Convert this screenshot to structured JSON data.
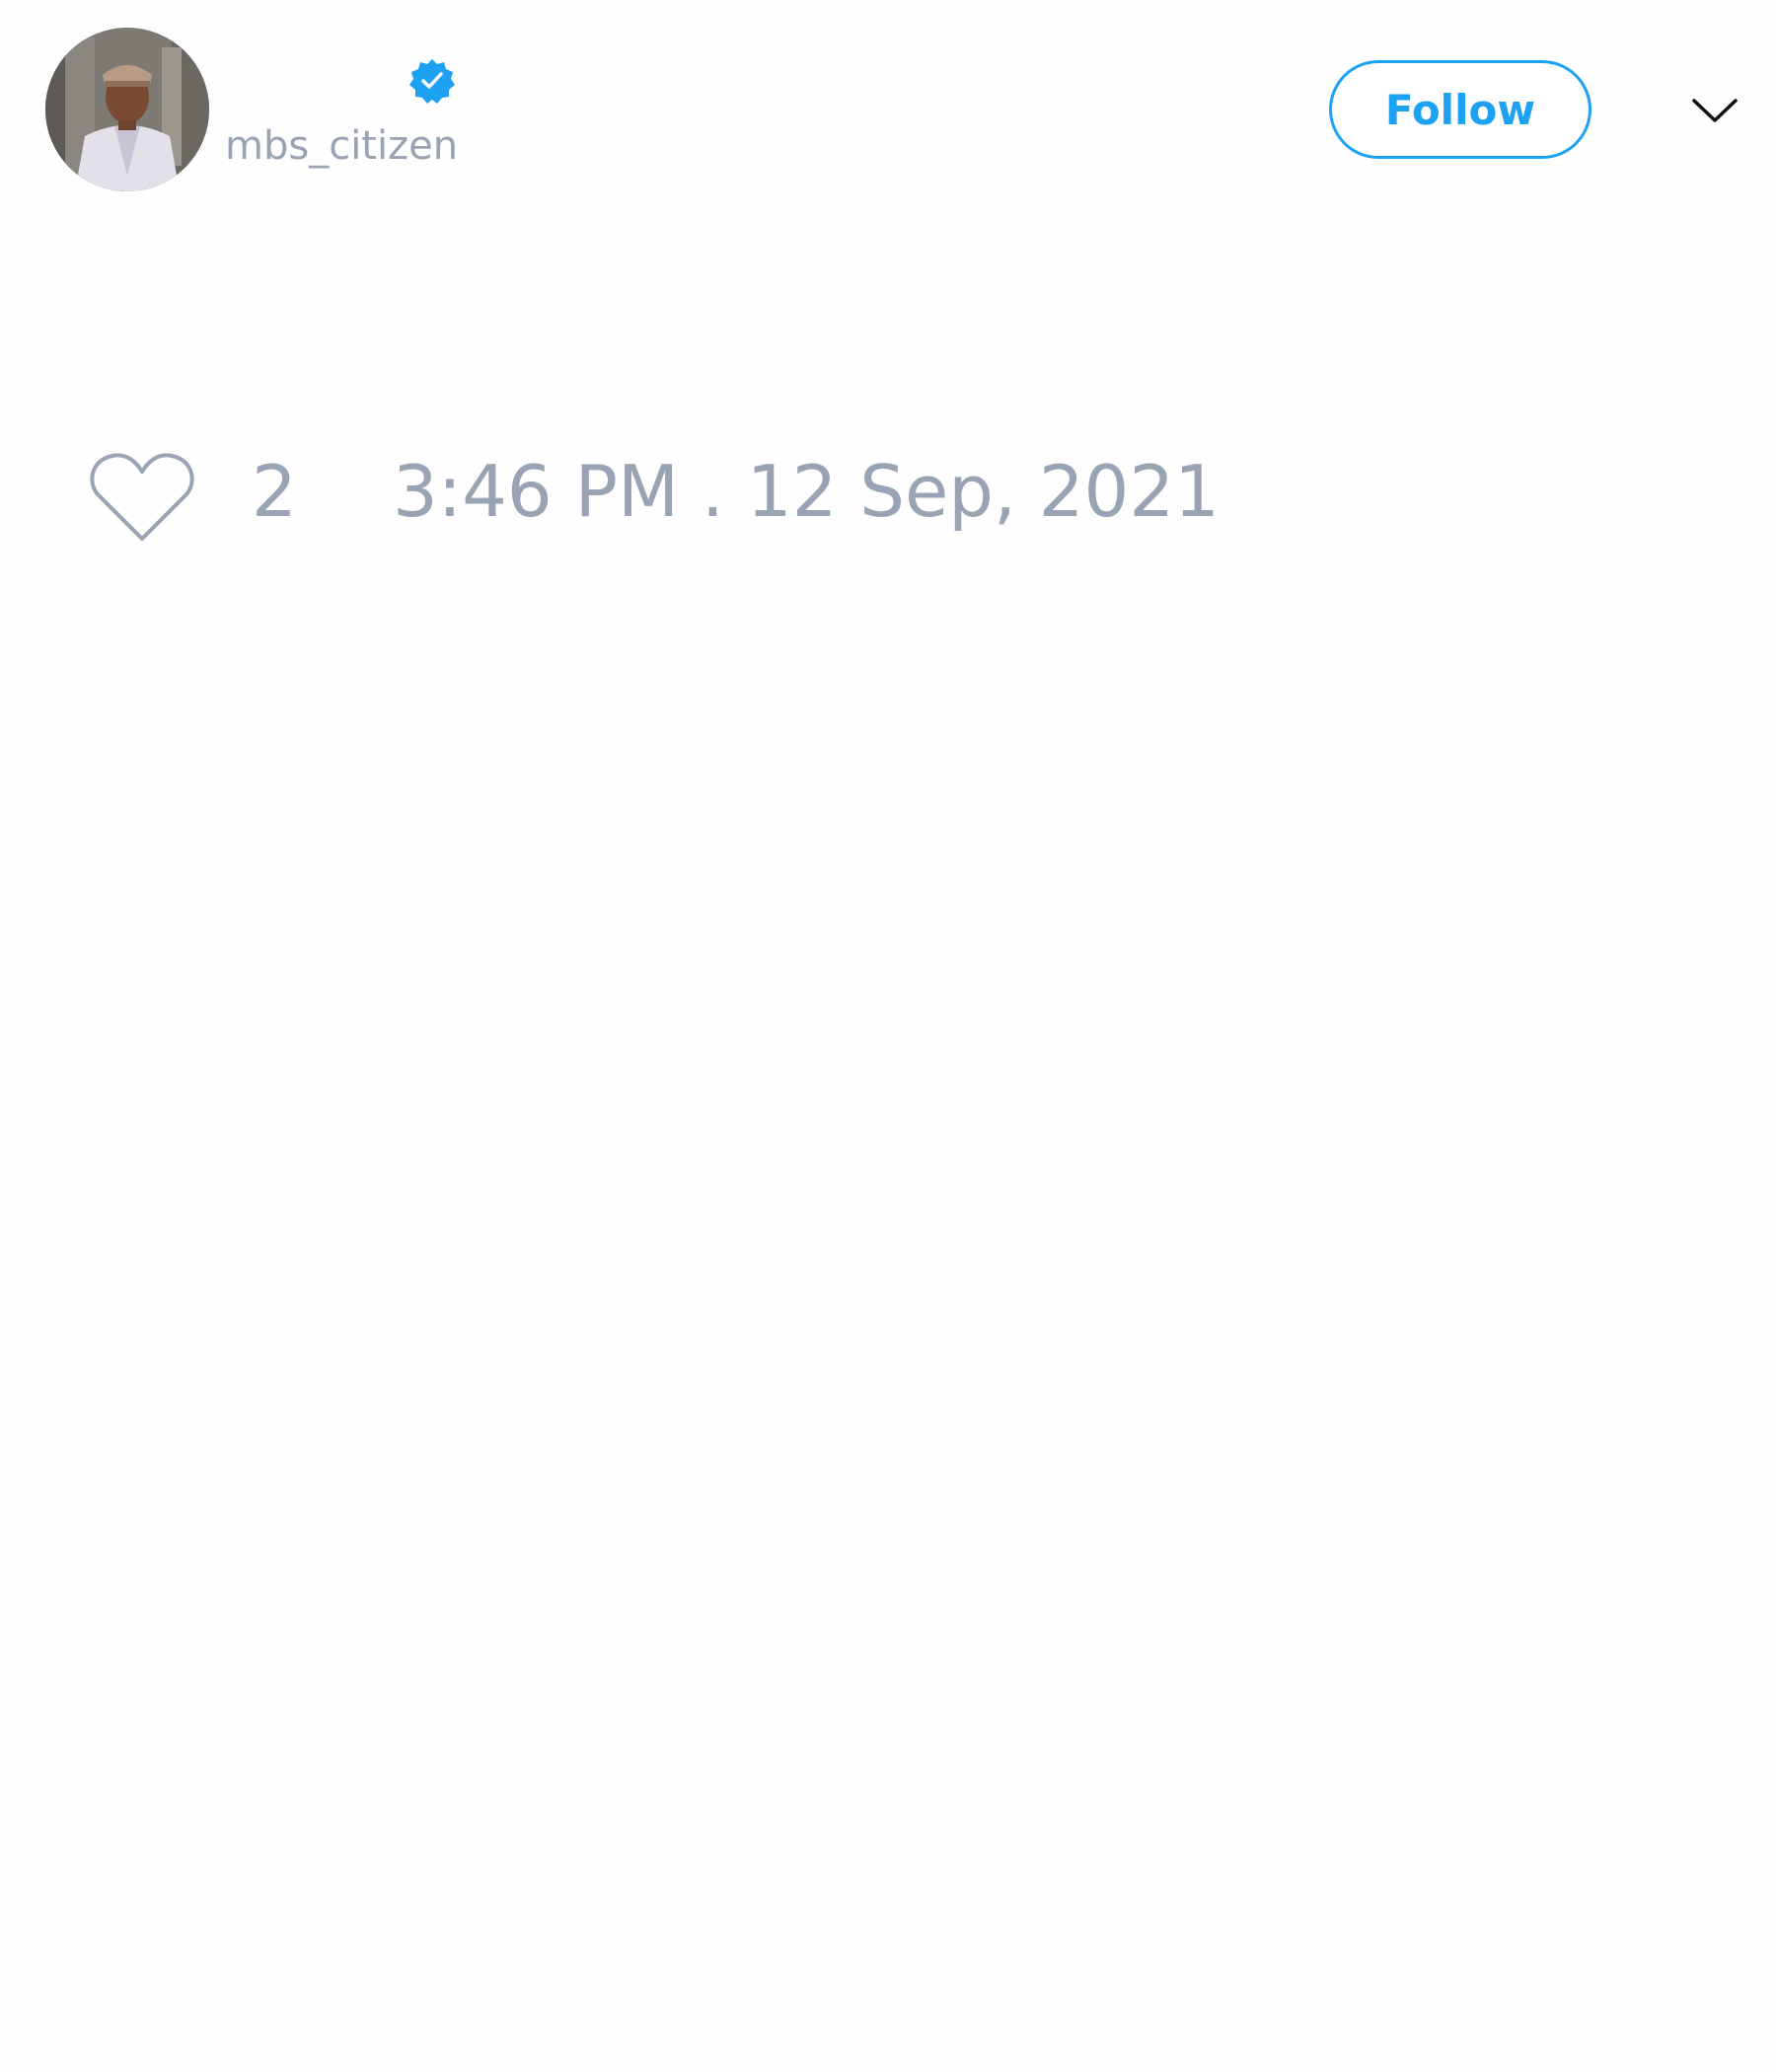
{
  "tweet": {
    "author": {
      "handle": "mbs_citizen",
      "verified_icon": "verified-badge-icon",
      "avatar_icon": "user-avatar"
    },
    "follow_button": {
      "label": "Follow"
    },
    "menu_icon": "chevron-down-icon",
    "like": {
      "icon": "heart-icon",
      "count": "2"
    },
    "timestamp": "3:46 PM . 12 Sep, 2021"
  },
  "colors": {
    "accent": "#1da1f2",
    "muted_text": "#98a3b4",
    "background": "#ffffff"
  }
}
